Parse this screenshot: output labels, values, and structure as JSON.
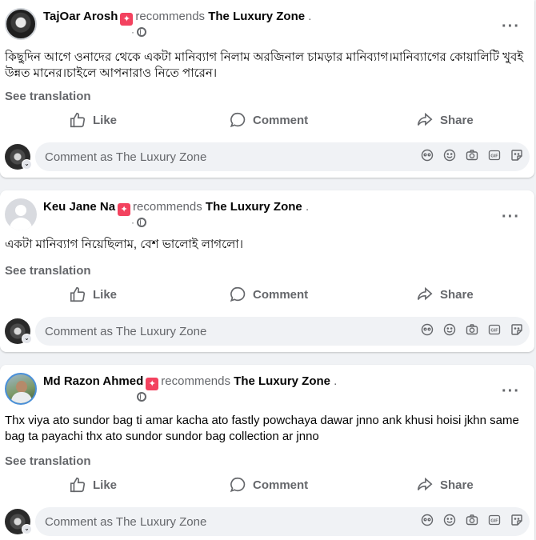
{
  "posts": [
    {
      "user": "TajOar Arosh",
      "recommends": "recommends",
      "page": "The Luxury Zone",
      "dot": ".",
      "meta": "·",
      "text": "কিছুদিন আগে ওনাদের থেকে একটা মানিব্যাগ নিলাম অরজিনাল চামড়ার মানিব্যাগ।মানিব্যাগের কোয়ালিটি খুবই উন্নত মানের।চাইলে আপনারাও নিতে পারেন।"
    },
    {
      "user": "Keu Jane Na",
      "recommends": "recommends",
      "page": "The Luxury Zone",
      "dot": ".",
      "meta": "·",
      "text": "একটা মানিব্যাগ নিয়েছিলাম, বেশ ভালোই লাগলো।"
    },
    {
      "user": "Md Razon Ahmed",
      "recommends": "recommends",
      "page": "The Luxury Zone",
      "dot": ".",
      "meta": "",
      "text": "Thx viya ato sundor bag ti amar kacha ato fastly powchaya dawar jnno ank khusi hoisi jkhn same bag ta payachi thx ato sundor sundor bag collection ar jnno"
    }
  ],
  "labels": {
    "see_translation": "See translation",
    "like": "Like",
    "comment": "Comment",
    "share": "Share",
    "comment_placeholder": "Comment as The Luxury Zone",
    "more": "···"
  },
  "icons": [
    "like-icon",
    "comment-icon",
    "share-icon",
    "avatar-icon",
    "emoji-icon",
    "camera-icon",
    "gif-icon",
    "sticker-icon",
    "globe-icon",
    "more-icon"
  ],
  "colors": {
    "badge": "#f3425f",
    "secondary_text": "#65676b",
    "input_bg": "#f0f2f5"
  }
}
